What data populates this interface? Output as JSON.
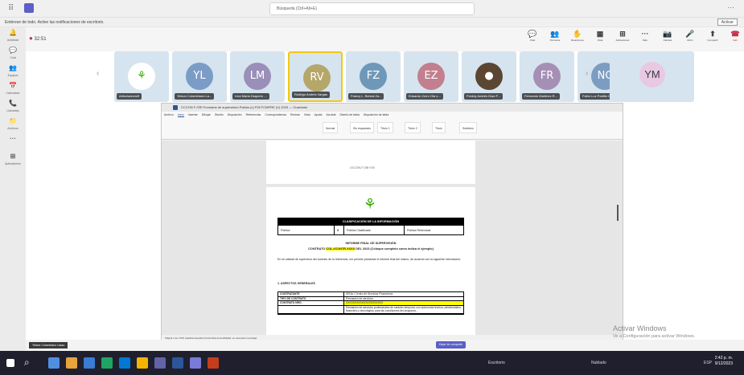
{
  "titlebar": {
    "search_placeholder": "Búsqueda (Ctrl+Alt+E)",
    "more": "···"
  },
  "notification": {
    "text": "Entérese de todo. Active las notificaciones de escritorio.",
    "activate_label": "Activar"
  },
  "rail": [
    {
      "icon": "bell-icon",
      "glyph": "🔔",
      "label": "Actividad"
    },
    {
      "icon": "chat-icon",
      "glyph": "💬",
      "label": "Chat"
    },
    {
      "icon": "teams-icon",
      "glyph": "👥",
      "label": "Equipos"
    },
    {
      "icon": "calendar-icon",
      "glyph": "📅",
      "label": "Calendario"
    },
    {
      "icon": "calls-icon",
      "glyph": "📞",
      "label": "Llamadas"
    },
    {
      "icon": "files-icon",
      "glyph": "📁",
      "label": "Archivos"
    },
    {
      "icon": "more-apps-icon",
      "glyph": "···",
      "label": ""
    },
    {
      "icon": "apps-icon",
      "glyph": "⊞",
      "label": "Aplicaciones"
    }
  ],
  "meeting": {
    "timer": "32:51",
    "buttons": [
      {
        "id": "chat",
        "glyph": "💬",
        "label": "Chat"
      },
      {
        "id": "people",
        "glyph": "👥",
        "label": "Personas"
      },
      {
        "id": "reactions",
        "glyph": "✋",
        "label": "Reacciones"
      },
      {
        "id": "view",
        "glyph": "▦",
        "label": "Vista"
      },
      {
        "id": "apps",
        "glyph": "⊞",
        "label": "Aplicaciones"
      },
      {
        "id": "more",
        "glyph": "···",
        "label": "Más"
      },
      {
        "id": "camera",
        "glyph": "📷",
        "label": "Cámara"
      },
      {
        "id": "mic",
        "glyph": "🎤",
        "label": "Micro"
      },
      {
        "id": "share",
        "glyph": "⬆",
        "label": "Compartir"
      },
      {
        "id": "leave",
        "glyph": "☎",
        "label": "Salir"
      }
    ]
  },
  "participants": [
    {
      "initials": "",
      "name": "Articulacionsff",
      "color": "#39a900",
      "is_logo": true
    },
    {
      "initials": "YL",
      "name": "Yeison Colombiano La...",
      "color": "#7a9cc6"
    },
    {
      "initials": "LM",
      "name": "Lina Maria Daquero ...",
      "color": "#9a8fb8"
    },
    {
      "initials": "RV",
      "name": "Rodrigo Andrés Vargas",
      "color": "#b5a66a",
      "active": true
    },
    {
      "initials": "FZ",
      "name": "Francy L. Bernal Za...",
      "color": "#6f98b8"
    },
    {
      "initials": "EZ",
      "name": "Eduardo Zorro Ola o...",
      "color": "#c27f8e"
    },
    {
      "initials": "",
      "name": "Freddy Andrés Díaz P...",
      "color": "#5a4632",
      "is_photo": true
    },
    {
      "initials": "FR",
      "name": "Fernando Martinez R...",
      "color": "#a68fb5"
    },
    {
      "initials": "NC",
      "name": "Fabio Luz Padilla Car...",
      "color": "#7c9dc1"
    }
  ],
  "overflow_participant": {
    "initials": "YM"
  },
  "word": {
    "title": "CCCON F-GRI Formatos de supervisión Pablos (v) F05 FCMPRE (V) 2023 — Guardado",
    "search": "Buscar",
    "tabs": [
      "Archivo",
      "Inicio",
      "Insertar",
      "Dibujar",
      "Diseño",
      "Disposición",
      "Referencias",
      "Correspondencia",
      "Revisar",
      "Vista",
      "Ayuda",
      "Acrobat",
      "Diseño de tabla",
      "Disposición de tabla"
    ],
    "active_tab": "Inicio",
    "styles": [
      "Normal",
      "Sin espaciado",
      "Título 1",
      "Título 2",
      "Título",
      "Subtítulo"
    ],
    "page1_footer": "GCCON-F-038 V05",
    "classification": {
      "header": "CLASIFICACIÓN DE LA INFORMACIÓN",
      "cols": [
        "Pública",
        "X",
        "Pública Clasificada",
        "Pública Reservada"
      ]
    },
    "report_title": "INFORME FINAL DE SUPERVISIÓN",
    "contract_line_a": "CONTRATO",
    "contract_highlight": "COL.#CONTR.XXXX",
    "contract_line_b": "DEL 2023 (Coloque completo como indica el ejemplo)",
    "intro": "En mi calidad de supervisor del contrato de la referencia, me permito presentar el informe final del mismo, de acuerdo con la siguiente información:",
    "section": "1.     ASPECTOS GENERALES",
    "table": [
      {
        "k": "CONTRATANTE",
        "v": "SENA / Centro de Servicios Financieros"
      },
      {
        "k": "TIPO DE CONTRATO",
        "v": "Prestación de servicios"
      },
      {
        "k": "CONTRATO NRO.",
        "v": "XXXXXXXXXXXXXXXXXXXXX",
        "hl": true
      },
      {
        "k": "",
        "v": "Prestación de servicios profesionales de carácter temporal, con autonomía técnica, administrativa, financiera y tecnológica, para las condiciones del programa..."
      }
    ],
    "status": "Página 1 de 3   507 palabras   Español (Colombia)   Accesibilidad: es necesario investigar",
    "sharer_name": "Yeison Colombiano Lasso",
    "stop_sharing": "Dejar de compartir"
  },
  "watermark": {
    "line1": "Activar Windows",
    "line2": "Ve a Configuración para activar Windows."
  },
  "taskbar": {
    "escritorio": "Escritorio",
    "weather": "Nublado",
    "lang": "ESP",
    "time": "2:42 p. m.",
    "date": "9/12/2023"
  }
}
